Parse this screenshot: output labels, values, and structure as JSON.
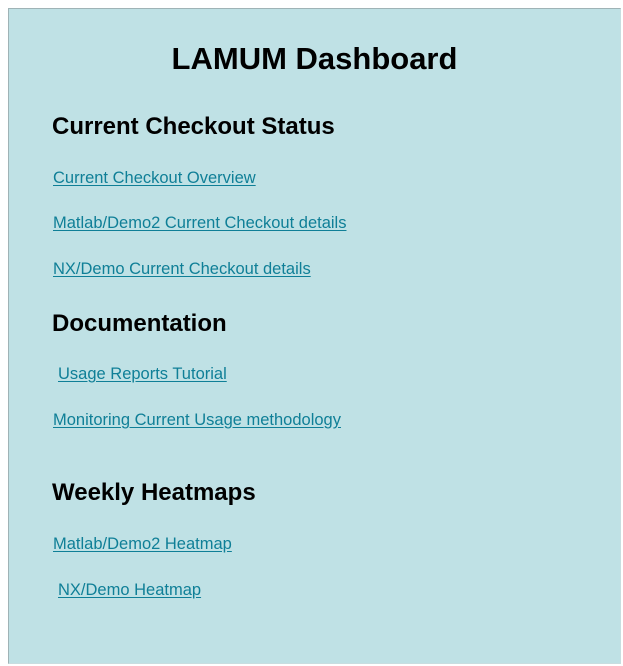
{
  "dashboard": {
    "title": "LAMUM Dashboard"
  },
  "sections": {
    "checkout": {
      "heading": "Current Checkout Status",
      "links": [
        "Current Checkout Overview",
        "Matlab/Demo2 Current Checkout details",
        "NX/Demo Current Checkout details"
      ]
    },
    "documentation": {
      "heading": "Documentation",
      "links": [
        "Usage Reports Tutorial",
        "Monitoring Current Usage methodology"
      ]
    },
    "heatmaps": {
      "heading": "Weekly Heatmaps",
      "links": [
        "Matlab/Demo2 Heatmap",
        "NX/Demo Heatmap"
      ]
    }
  },
  "colors": {
    "panel_background": "#bfe1e5",
    "link": "#0f7f97",
    "heading": "#000000"
  }
}
